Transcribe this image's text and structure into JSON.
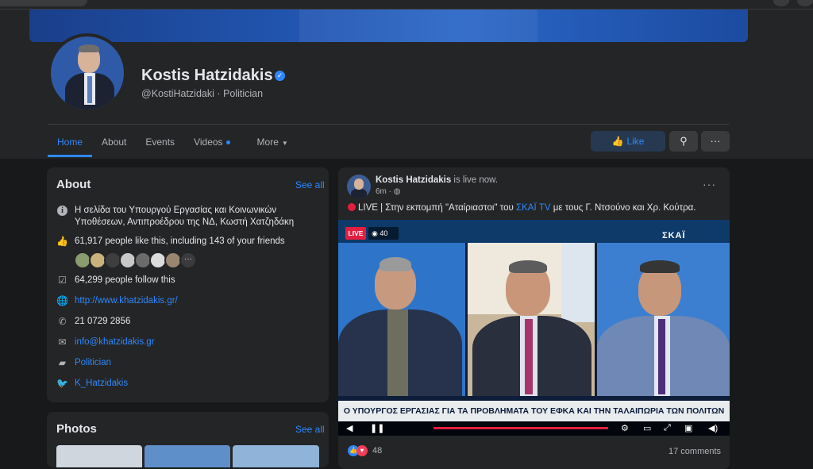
{
  "profile": {
    "name": "Kostis Hatzidakis",
    "handle_line": "@KostiHatzidaki · Politician"
  },
  "nav": {
    "tabs": [
      "Home",
      "About",
      "Events",
      "Videos",
      "More"
    ],
    "active": "Home",
    "like_label": "Like",
    "search_icon": "search-icon",
    "more_icon": "ellipsis-icon"
  },
  "about": {
    "title": "About",
    "see_all": "See all",
    "description": "Η σελίδα του Υπουργού Εργασίας και Κοινωνικών Υποθέσεων, Αντιπροέδρου της ΝΔ, Κωστή Χατζηδάκη",
    "likes": "61,917 people like this, including 143 of your friends",
    "follows": "64,299 people follow this",
    "website": "http://www.khatzidakis.gr/",
    "phone": "21 0729 2856",
    "email": "info@khatzidakis.gr",
    "category": "Politician",
    "twitter": "K_Hatzidakis",
    "friend_more": "···"
  },
  "photos": {
    "title": "Photos",
    "see_all": "See all"
  },
  "post": {
    "author": "Kostis Hatzidakis",
    "status": " is live now.",
    "time": "6m · ",
    "text_pre": "LIVE | Στην εκπομπή \"Αταίριαστοι\" του ",
    "text_link": "ΣΚΑΪ TV",
    "text_post": " με τους Γ. Ντσούνο και Χρ. Κούτρα.",
    "live_badge": "LIVE",
    "viewers": "40",
    "channel_logo": "ΣΚΑΪ",
    "ticker": "Ο ΥΠΟΥΡΓΟΣ ΕΡΓΑΣΙΑΣ ΓΙΑ ΤΑ ΠΡΟΒΛΗΜΑΤΑ ΤΟΥ ΕΦΚΑ ΚΑΙ ΤΗΝ ΤΑΛΑΙΠΩΡΙΑ ΤΩΝ ΠΟΛΙΤΩΝ",
    "reactions": "48",
    "comments": "17 comments"
  },
  "colors": {
    "accent": "#2d88ff",
    "background": "#18191a",
    "card": "#242526",
    "live": "#e41e3f"
  }
}
